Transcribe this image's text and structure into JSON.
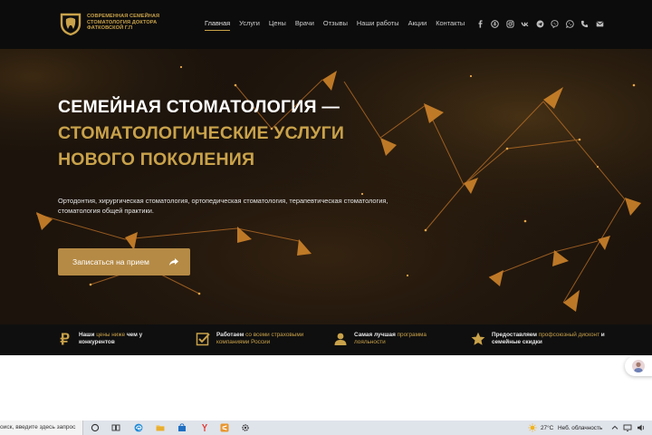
{
  "header": {
    "brand_lines": [
      "СОВРЕМЕННАЯ СЕМЕЙНАЯ",
      "СТОМАТОЛОГИЯ ДОКТОРА",
      "ФАТКОВСКОЙ Г.П"
    ],
    "nav": [
      "Главная",
      "Услуги",
      "Цены",
      "Врачи",
      "Отзывы",
      "Наши работы",
      "Акции",
      "Контакты"
    ],
    "active_nav": 0,
    "socials": [
      "facebook-icon",
      "odnoklassniki-icon",
      "instagram-icon",
      "vk-icon",
      "telegram-icon",
      "viber-icon",
      "whatsapp-icon",
      "phone-icon",
      "mail-icon"
    ]
  },
  "hero": {
    "title_line1": "СЕМЕЙНАЯ СТОМАТОЛОГИЯ —",
    "title_line2": "СТОМАТОЛОГИЧЕСКИЕ УСЛУГИ",
    "title_line3": "НОВОГО ПОКОЛЕНИЯ",
    "description": "Ортодонтия, хирургическая стоматология, ортопедическая стоматология, терапевтическая стоматология, стоматология общей практики.",
    "cta_label": "Записаться на прием"
  },
  "features": [
    {
      "icon": "ruble-icon",
      "pre": "Наши ",
      "highlight": "цены ниже",
      "post": " чем у конкурентов"
    },
    {
      "icon": "checklist-icon",
      "pre": "Работаем ",
      "highlight": "со всеми страховыми компаниями России",
      "post": ""
    },
    {
      "icon": "user-icon",
      "pre": "Самая лучшая ",
      "highlight": "программа лояльности",
      "post": ""
    },
    {
      "icon": "star-icon",
      "pre": "Предоставляем ",
      "highlight": "профсоюзный дисконт",
      "post": " и семейные скидки"
    }
  ],
  "taskbar": {
    "search_placeholder": "оиск, введите здесь запрос",
    "temperature": "27°C",
    "weather": "Неб. облачность"
  },
  "colors": {
    "gold": "#c9a24a",
    "header_bg": "#0c0c0c",
    "cta_bg": "#b58a45",
    "hero_bg": "#1a120b"
  }
}
